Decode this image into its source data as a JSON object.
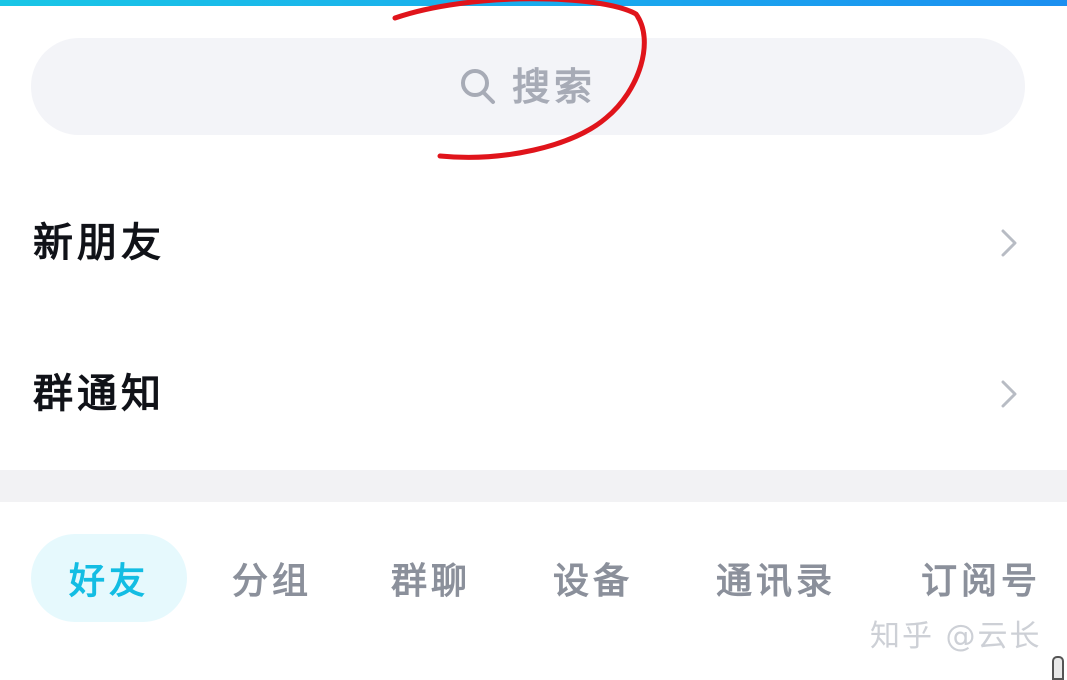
{
  "search": {
    "placeholder": "搜索",
    "icon": "search-icon"
  },
  "menu": [
    {
      "label": "新朋友",
      "icon": "chevron-right-icon"
    },
    {
      "label": "群通知",
      "icon": "chevron-right-icon"
    }
  ],
  "tabs": [
    {
      "label": "好友",
      "active": true
    },
    {
      "label": "分组",
      "active": false
    },
    {
      "label": "群聊",
      "active": false
    },
    {
      "label": "设备",
      "active": false
    },
    {
      "label": "通讯录",
      "active": false
    },
    {
      "label": "订阅号",
      "active": false
    }
  ],
  "watermark": "知乎 @云长",
  "colors": {
    "accent": "#13bde3",
    "active_tab_bg": "#e6f9fd",
    "search_bg": "#f3f4f8",
    "annotation": "#e0141b",
    "top_bar": "#1aa7ee"
  }
}
